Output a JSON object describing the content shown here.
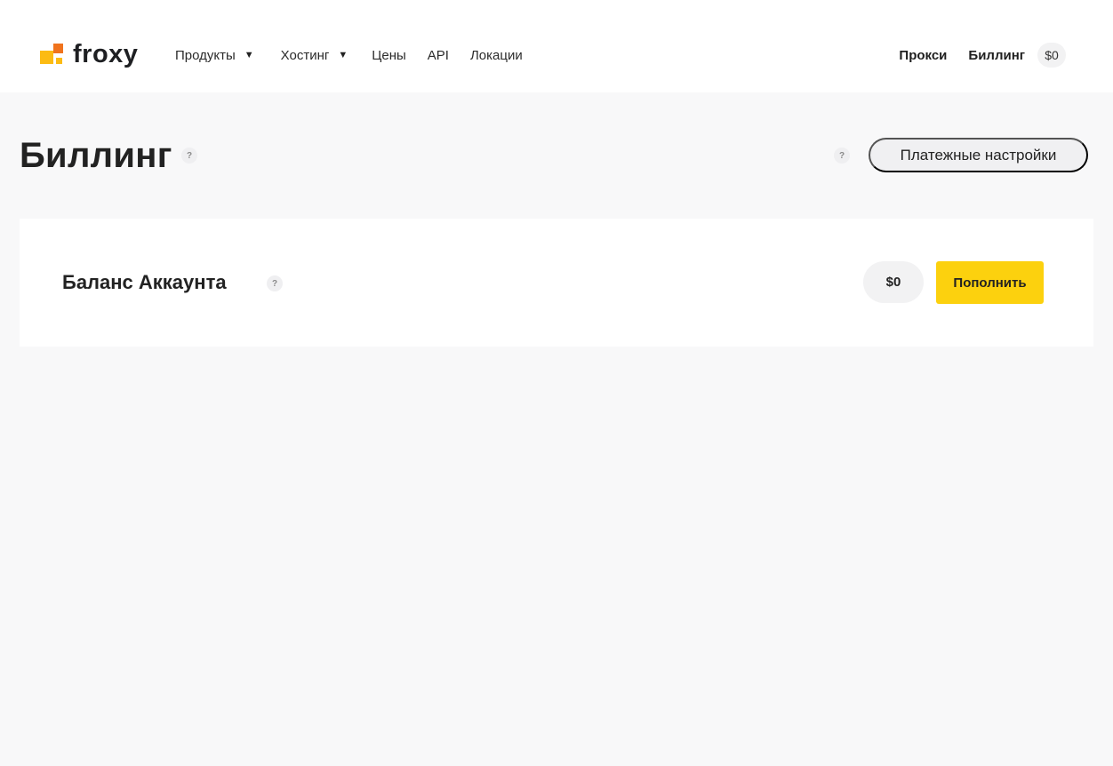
{
  "header": {
    "logo_text": "froxy",
    "nav": [
      {
        "label": "Продукты",
        "has_dropdown": true
      },
      {
        "label": "Хостинг",
        "has_dropdown": true
      },
      {
        "label": "Цены",
        "has_dropdown": false
      },
      {
        "label": "API",
        "has_dropdown": false
      },
      {
        "label": "Локации",
        "has_dropdown": false
      }
    ],
    "caret_glyph": "▼",
    "right": {
      "proxy_label": "Прокси",
      "billing_label": "Биллинг",
      "balance": "$0"
    }
  },
  "page": {
    "title": "Биллинг",
    "help_glyph": "?",
    "payment_settings_label": "Платежные настройки"
  },
  "balance_card": {
    "title": "Баланс Аккаунта",
    "amount": "$0",
    "topup_label": "Пополнить"
  },
  "colors": {
    "accent_yellow": "#fcd10e",
    "logo_orange": "#f0731d",
    "logo_yellow": "#fcbb13",
    "page_background": "#f8f8f9"
  },
  "icons": {
    "logo": "froxy-logo-icon",
    "dropdown": "caret-down-icon",
    "help": "question-mark-icon"
  }
}
